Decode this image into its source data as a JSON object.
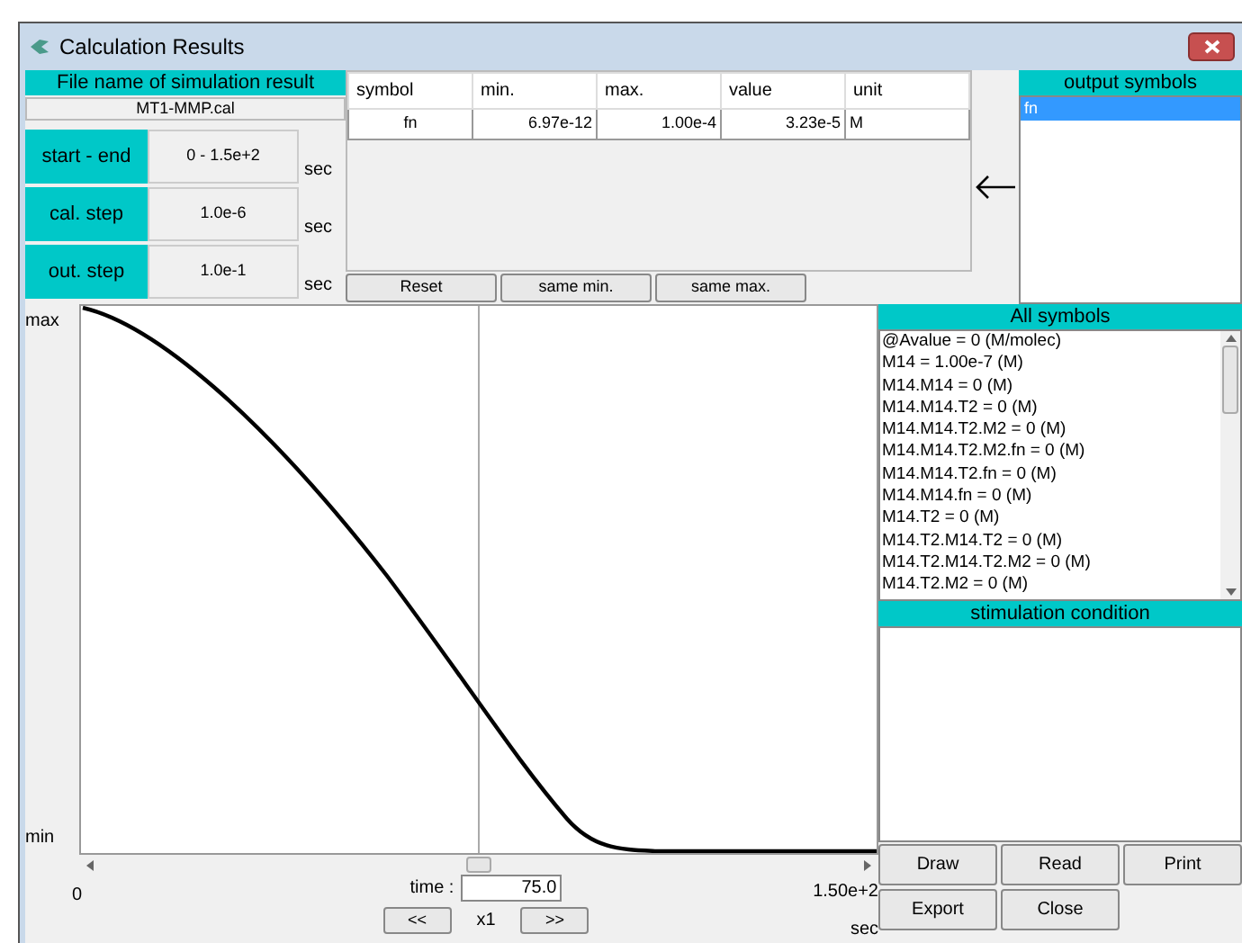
{
  "window": {
    "title": "Calculation Results"
  },
  "file": {
    "header": "File name of simulation result",
    "name": "MT1-MMP.cal"
  },
  "settings": [
    {
      "label": "start - end",
      "value": "0 - 1.5e+2",
      "unit": "sec"
    },
    {
      "label": "cal. step",
      "value": "1.0e-6",
      "unit": "sec"
    },
    {
      "label": "out. step",
      "value": "1.0e-1",
      "unit": "sec"
    }
  ],
  "table": {
    "columns": [
      "symbol",
      "min.",
      "max.",
      "value",
      "unit"
    ],
    "rows": [
      [
        "fn",
        "6.97e-12",
        "1.00e-4",
        "3.23e-5",
        "M"
      ]
    ]
  },
  "table_buttons": [
    "Reset",
    "same min.",
    "same max."
  ],
  "output_symbols": {
    "header": "output symbols",
    "items": [
      {
        "label": "fn",
        "selected": true
      }
    ]
  },
  "graph": {
    "y_max": "max",
    "y_min": "min",
    "x_start": "0",
    "x_end": "1.50e+2",
    "x_unit": "sec",
    "time_label": "time :",
    "time_value": "75.0",
    "zoom_down": "<<",
    "zoom": "x1",
    "zoom_up": ">>"
  },
  "all_symbols": {
    "header": "All symbols",
    "items": [
      "@Avalue = 0 (M/molec)",
      "M14 = 1.00e-7 (M)",
      "M14.M14 = 0 (M)",
      "M14.M14.T2 = 0 (M)",
      "M14.M14.T2.M2 = 0 (M)",
      "M14.M14.T2.M2.fn = 0 (M)",
      "M14.M14.T2.fn = 0 (M)",
      "M14.M14.fn = 0 (M)",
      "M14.T2 = 0 (M)",
      "M14.T2.M14.T2 = 0 (M)",
      "M14.T2.M14.T2.M2 = 0 (M)",
      "M14.T2.M2 = 0 (M)"
    ]
  },
  "stimulation": {
    "header": "stimulation condition"
  },
  "buttons": [
    [
      "Draw",
      "Read",
      "Print"
    ],
    [
      "Export",
      "Close"
    ]
  ]
}
